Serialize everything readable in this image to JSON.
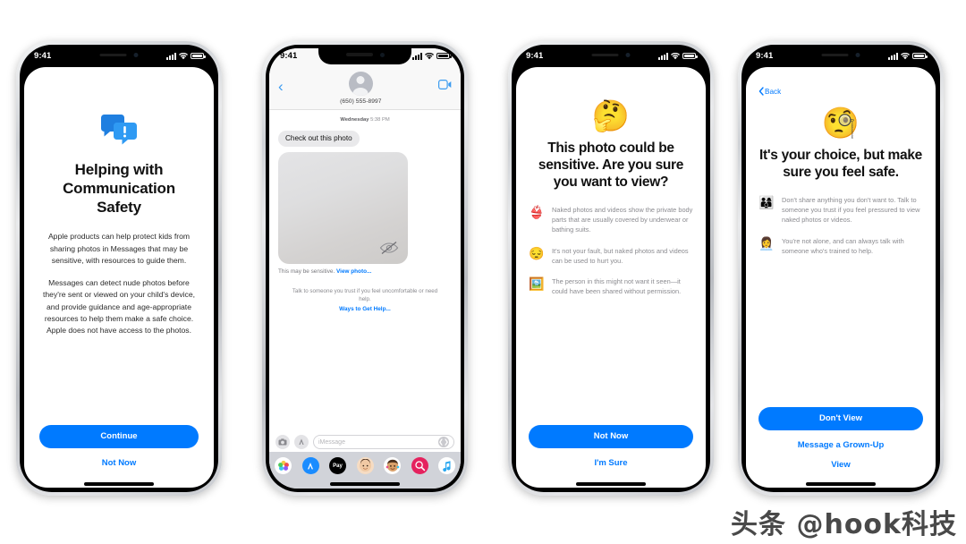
{
  "meta": {
    "watermark": "头条 @hook科技"
  },
  "status_bar": {
    "time": "9:41",
    "signal_icon": "cellular-bars-icon",
    "wifi_icon": "wifi-icon",
    "battery_icon": "battery-icon"
  },
  "phones": [
    {
      "id": "phone-intro",
      "screen": "communication-safety-intro",
      "app_icon": "speech-bubbles-alert-icon",
      "title": "Helping with Communication Safety",
      "paragraphs": [
        "Apple products can help protect kids from sharing photos in Messages that may be sensitive, with resources to guide them.",
        "Messages can detect nude photos before they're sent or viewed on your child's device, and provide guidance and age-appropriate resources to help them make a safe choice. Apple does not have access to the photos."
      ],
      "primary_button": "Continue",
      "secondary_button": "Not Now"
    },
    {
      "id": "phone-messages",
      "screen": "messages-conversation",
      "header": {
        "back_icon": "chevron-left-icon",
        "avatar_icon": "contact-avatar-icon",
        "contact": "(650) 555-8997",
        "contact_chevron": "›",
        "facetime_icon": "video-camera-icon"
      },
      "day_stamp_day": "Wednesday",
      "day_stamp_time": "5:38 PM",
      "incoming_message": "Check out this photo",
      "photo_overlay_icon": "eye-slash-icon",
      "sensitive_label": "This may be sensitive.",
      "sensitive_link": "View photo...",
      "helper_text": "Talk to someone you trust if you feel uncomfortable or need help.",
      "helper_link": "Ways to Get Help...",
      "composer": {
        "camera_icon": "camera-icon",
        "appstore_icon": "app-store-icon",
        "placeholder": "iMessage",
        "mic_icon": "audio-waveform-icon"
      },
      "app_drawer": [
        {
          "name": "photos-app-icon",
          "glyph": "❀",
          "bg": "#ffffff"
        },
        {
          "name": "app-store-app-icon",
          "glyph": "A",
          "bg": "#1a8cff"
        },
        {
          "name": "apple-pay-app-icon",
          "glyph": "Pay",
          "bg": "#000000"
        },
        {
          "name": "memoji-app-icon",
          "glyph": "🙂",
          "bg": "#ffffff"
        },
        {
          "name": "memoji-stickers-app-icon",
          "glyph": "🧑",
          "bg": "#ffffff"
        },
        {
          "name": "images-search-app-icon",
          "glyph": "#",
          "bg": "#e5225e"
        },
        {
          "name": "music-app-icon",
          "glyph": "♫",
          "bg": "#ffffff"
        }
      ]
    },
    {
      "id": "phone-warning",
      "screen": "sensitive-photo-warning",
      "hero_emoji": "🤔",
      "hero_emoji_name": "thinking-face-emoji",
      "title": "This photo could be sensitive. Are you sure you want to view?",
      "bullets": [
        {
          "icon": "👙",
          "icon_name": "swimsuit-emoji",
          "text": "Naked photos and videos show the private body parts that are usually covered by underwear or bathing suits."
        },
        {
          "icon": "😔",
          "icon_name": "pensive-face-emoji",
          "text": "It's not your fault, but naked photos and videos can be used to hurt you."
        },
        {
          "icon": "🖼️",
          "icon_name": "framed-picture-emoji",
          "text": "The person in this might not want it seen—it could have been shared without permission."
        }
      ],
      "primary_button": "Not Now",
      "secondary_button": "I'm Sure"
    },
    {
      "id": "phone-choice",
      "screen": "your-choice-warning",
      "back_label": "Back",
      "back_icon": "chevron-left-icon",
      "hero_emoji": "🧐",
      "hero_emoji_name": "monocle-face-emoji",
      "title": "It's your choice, but make sure you feel safe.",
      "bullets": [
        {
          "icon": "👨‍👩‍👦",
          "icon_name": "family-emoji",
          "text": "Don't share anything you don't want to. Talk to someone you trust if you feel pressured to view naked photos or videos."
        },
        {
          "icon": "👩‍💼",
          "icon_name": "counselor-emoji",
          "text": "You're not alone, and can always talk with someone who's trained to help."
        }
      ],
      "primary_button": "Don't View",
      "secondary_button": "Message a Grown-Up",
      "tertiary_button": "View"
    }
  ],
  "colors": {
    "accent_blue": "#007aff",
    "bubble_gray": "#e9e9eb",
    "muted_text": "#8b8b90"
  }
}
